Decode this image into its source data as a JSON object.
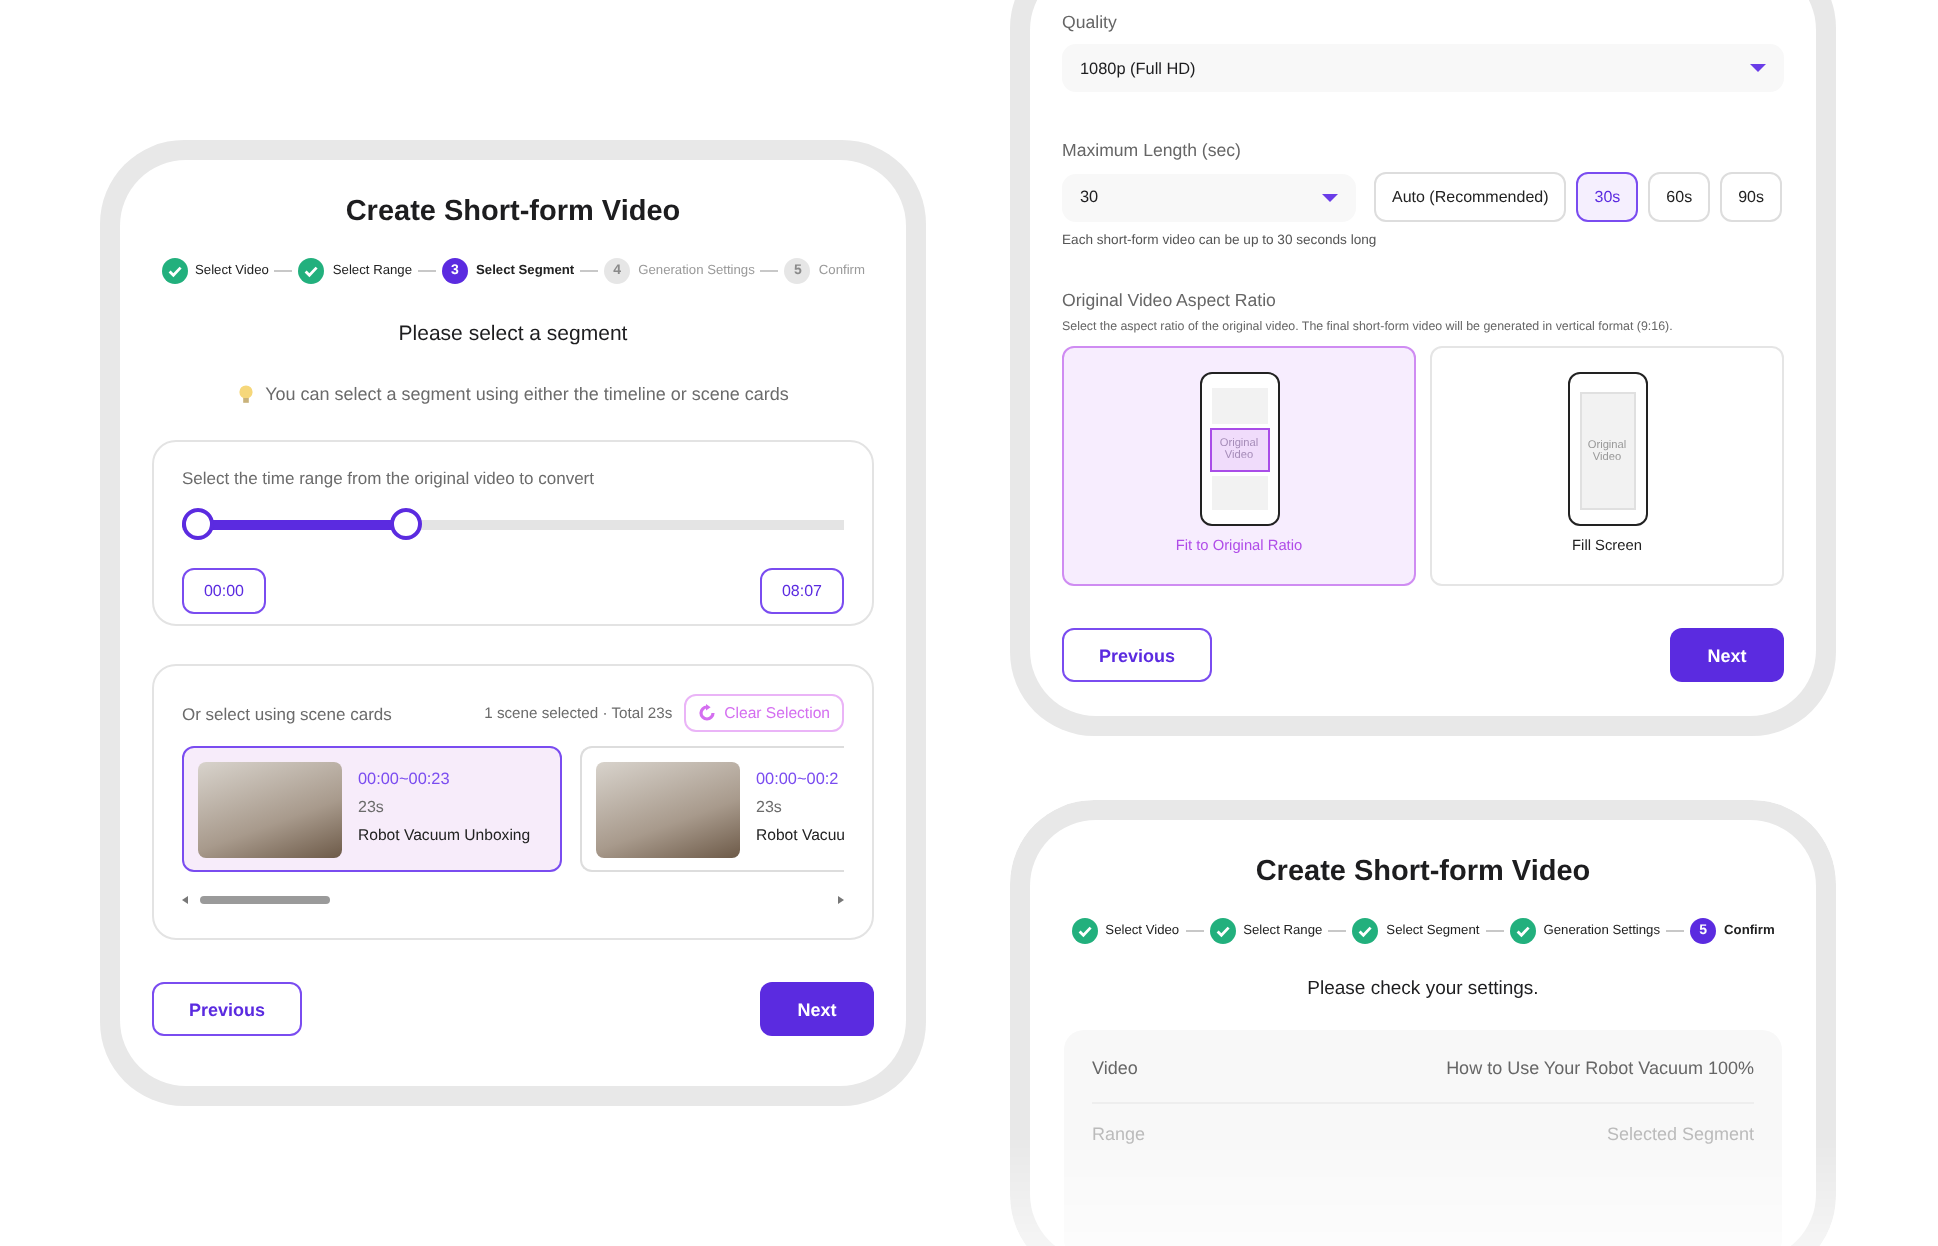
{
  "segment_panel": {
    "title": "Create Short-form Video",
    "steps": [
      {
        "label": "Select Video",
        "done": true,
        "current": false
      },
      {
        "label": "Select Range",
        "done": true,
        "current": false
      },
      {
        "number": "3",
        "label": "Select Segment",
        "done": false,
        "current": true
      },
      {
        "number": "4",
        "label": "Generation Settings",
        "done": false,
        "current": false
      },
      {
        "number": "5",
        "label": "Confirm",
        "done": false,
        "current": false
      }
    ],
    "heading": "Please select a segment",
    "tip": "You can select a segment using either the timeline or scene cards",
    "timeline": {
      "label": "Select the time range from the original video to convert",
      "level": 0.33,
      "start_time": "00:00",
      "end_time": "08:07"
    },
    "scenes": {
      "label": "Or select using scene cards",
      "summary": "1 scene selected · Total 23s",
      "clear_button": "Clear Selection",
      "cards": [
        {
          "time": "00:00~00:23",
          "duration": "23s",
          "title": "Robot Vacuum Unboxing",
          "selected": true
        },
        {
          "time": "00:00~00:2",
          "duration": "23s",
          "title": "Robot Vacuu",
          "selected": false
        }
      ]
    },
    "buttons": {
      "previous": "Previous",
      "next": "Next"
    }
  },
  "settings_panel": {
    "quality": {
      "label": "Quality",
      "value": "1080p (Full HD)"
    },
    "max_length": {
      "label": "Maximum Length (sec)",
      "value": "30",
      "options": [
        {
          "label": "Auto (Recommended)",
          "selected": false
        },
        {
          "label": "30s",
          "selected": true
        },
        {
          "label": "60s",
          "selected": false
        },
        {
          "label": "90s",
          "selected": false
        }
      ],
      "hint": "Each short-form video can be up to 30 seconds long"
    },
    "aspect": {
      "title": "Original Video Aspect Ratio",
      "description": "Select the aspect ratio of the original video. The final short-form video will be generated in vertical format (9:16).",
      "options": [
        {
          "kind": "fit",
          "preview_text": "Original Video",
          "label": "Fit to Original Ratio",
          "selected": true
        },
        {
          "kind": "fill",
          "preview_text": "Original Video",
          "label": "Fill Screen",
          "selected": false
        }
      ]
    },
    "buttons": {
      "previous": "Previous",
      "next": "Next"
    }
  },
  "confirm_panel": {
    "title": "Create Short-form Video",
    "steps": [
      {
        "label": "Select Video",
        "done": true,
        "current": false
      },
      {
        "label": "Select Range",
        "done": true,
        "current": false
      },
      {
        "label": "Select Segment",
        "done": true,
        "current": false
      },
      {
        "label": "Generation Settings",
        "done": true,
        "current": false
      },
      {
        "number": "5",
        "label": "Confirm",
        "done": false,
        "current": true
      }
    ],
    "heading": "Please check your settings.",
    "rows": [
      {
        "label": "Video",
        "value": "How to Use Your Robot Vacuum 100%"
      },
      {
        "label": "Range",
        "value": "Selected Segment"
      }
    ]
  }
}
